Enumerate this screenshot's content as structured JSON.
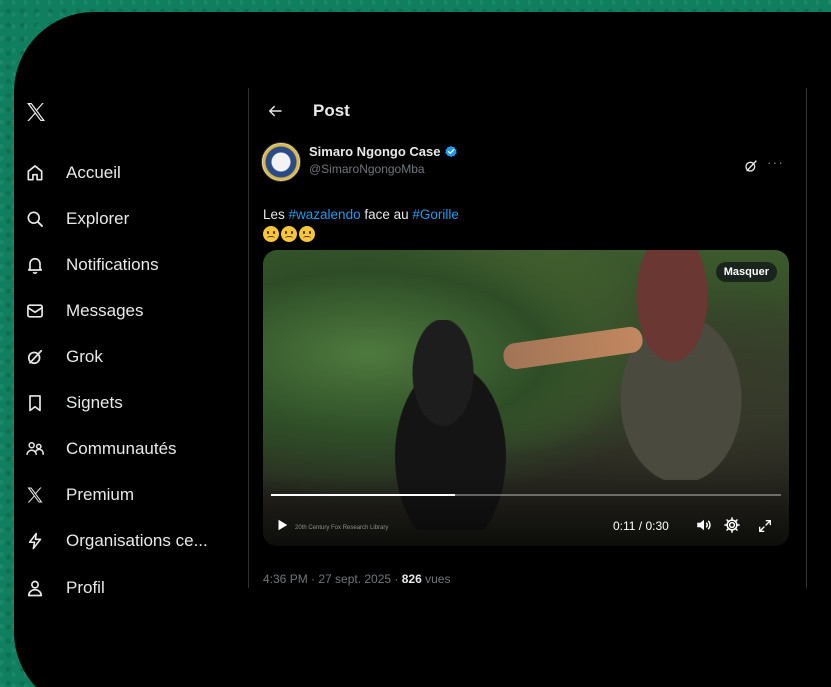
{
  "sidebar": {
    "items": [
      {
        "label": "Accueil",
        "icon": "home-icon"
      },
      {
        "label": "Explorer",
        "icon": "search-icon"
      },
      {
        "label": "Notifications",
        "icon": "bell-icon"
      },
      {
        "label": "Messages",
        "icon": "mail-icon"
      },
      {
        "label": "Grok",
        "icon": "grok-icon"
      },
      {
        "label": "Signets",
        "icon": "bookmark-icon"
      },
      {
        "label": "Communautés",
        "icon": "communities-icon"
      },
      {
        "label": "Premium",
        "icon": "x-logo-icon"
      },
      {
        "label": "Organisations ce...",
        "icon": "lightning-icon"
      },
      {
        "label": "Profil",
        "icon": "person-icon"
      }
    ]
  },
  "header": {
    "title": "Post"
  },
  "tweet": {
    "author_name": "Simaro Ngongo Case",
    "author_handle": "@SimaroNgongoMba",
    "more": "···",
    "text_prefix": "Les ",
    "hashtag1": "#wazalendo",
    "text_middle": " face au ",
    "hashtag2": "#Gorille",
    "emoji_count": 3,
    "timestamp_date": "4:36 PM · 27 sept. 2025 · ",
    "views_count": "826",
    "views_label": " vues"
  },
  "video": {
    "hide_label": "Masquer",
    "time": "0:11 / 0:30",
    "watermark": "20th Century Fox Research Library",
    "progress": 0.36
  },
  "colors": {
    "accent": "#1d9bf0",
    "background_outer": "#0f7f5f",
    "background_app": "#000000",
    "muted_text": "#71767b"
  }
}
